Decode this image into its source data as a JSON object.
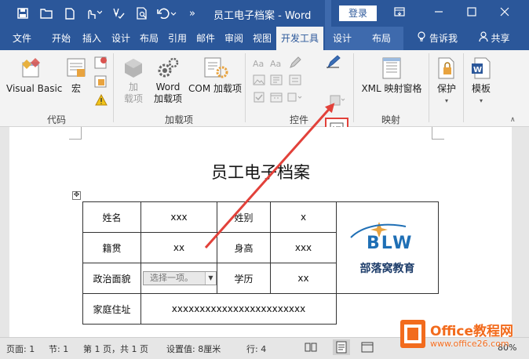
{
  "titlebar": {
    "title": "员工电子档案  -  Word",
    "login_label": "登录",
    "more": "»"
  },
  "tabs": [
    "文件",
    "开始",
    "插入",
    "设计",
    "布局",
    "引用",
    "邮件",
    "审阅",
    "视图",
    "开发工具",
    "设计",
    "布局"
  ],
  "tell_me": "告诉我",
  "share": "共享",
  "ribbon": {
    "code": {
      "visual_basic": "Visual Basic",
      "macro": "宏",
      "label": "代码"
    },
    "addins": {
      "addins": "加\n载项",
      "word_addins_1": "Word",
      "word_addins_2": "加载项",
      "com_addins": "COM 加载项",
      "label": "加载项"
    },
    "controls": {
      "label": "控件"
    },
    "mapping": {
      "xml_pane": "XML 映射窗格",
      "label": "映射"
    },
    "protect": {
      "protect": "保护"
    },
    "templates": {
      "template": "模板"
    }
  },
  "document": {
    "title": "员工电子档案",
    "table": {
      "name_label": "姓名",
      "name_value": "xxx",
      "gender_label": "姓别",
      "gender_value": "x",
      "native_label": "籍贯",
      "native_value": "xx",
      "height_label": "身高",
      "height_value": "xxx",
      "political_label": "政治面貌",
      "political_placeholder": "选择一项。",
      "education_label": "学历",
      "education_value": "xx",
      "address_label": "家庭住址",
      "address_value": "xxxxxxxxxxxxxxxxxxxxxxxx"
    },
    "logo_text": "部落窝教育",
    "logo_letters": "BLW"
  },
  "status": {
    "page": "页面: 1",
    "section": "节: 1",
    "pages": "第 1 页，共 1 页",
    "position": "设置值: 8厘米",
    "line": "行: 4",
    "zoom": "80%"
  },
  "watermark": {
    "brand": "Office教程网",
    "url": "www.office26.com"
  },
  "colors": {
    "brand": "#2b579a",
    "accent": "#e2413a",
    "watermark": "#f26b1d"
  }
}
